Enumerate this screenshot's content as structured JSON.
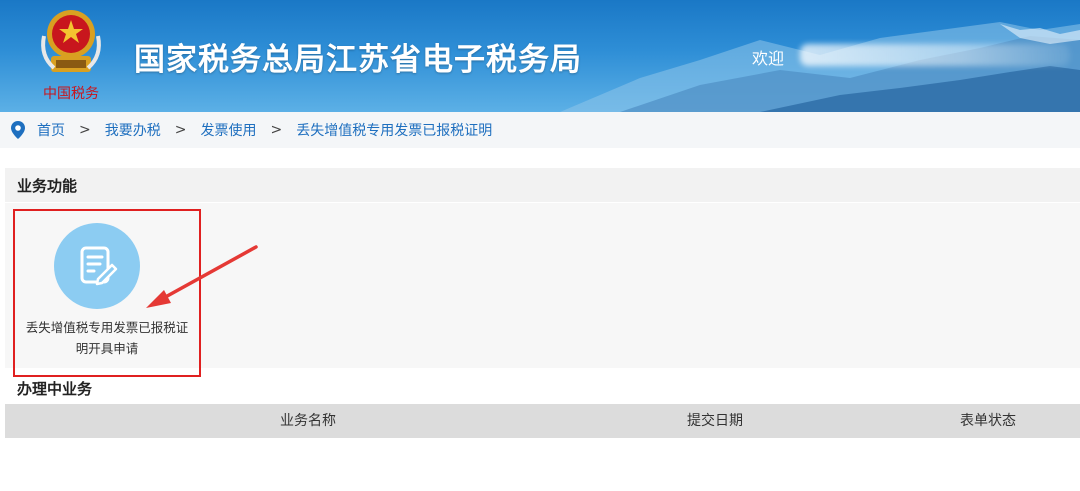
{
  "header": {
    "site_title": "国家税务总局江苏省电子税务局",
    "welcome_prefix": "欢迎",
    "emblem_caption": "中国税务"
  },
  "breadcrumb": {
    "items": [
      "首页",
      "我要办税",
      "发票使用",
      "丢失增值税专用发票已报税证明"
    ],
    "separator": ">"
  },
  "business_functions": {
    "title": "业务功能",
    "tiles": [
      {
        "label": "丢失增值税专用发票已报税证明开具申请",
        "icon": "document-edit-icon"
      }
    ]
  },
  "in_progress": {
    "title": "办理中业务",
    "columns": [
      "业务名称",
      "提交日期",
      "表单状态"
    ],
    "rows": []
  },
  "colors": {
    "header_blue": "#1a78c6",
    "link_blue": "#1e6fbf",
    "highlight_red": "#e02020",
    "icon_circle": "#8cccf2"
  }
}
